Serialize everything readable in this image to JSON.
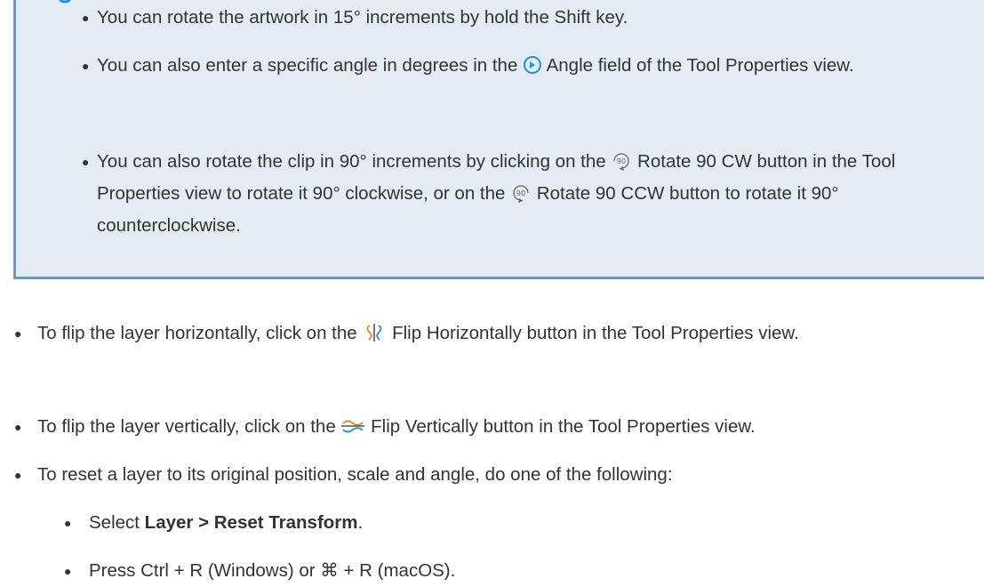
{
  "tip": {
    "items": [
      {
        "text": "You can rotate the artwork in 15° increments by hold the Shift key."
      },
      {
        "pre": "You can also enter a specific angle in degrees in the ",
        "icon": "angle-icon",
        "post": " Angle field of the Tool Properties view."
      },
      {
        "pre": "You can also rotate the clip in 90° increments by clicking on the ",
        "icon": "rotate-90-cw-icon",
        "mid": " Rotate 90 CW button in the Tool Properties view to rotate it 90° clockwise, or on the ",
        "icon2": "rotate-90-ccw-icon",
        "post": " Rotate 90 CCW button to rotate it 90° counterclockwise."
      }
    ]
  },
  "steps": [
    {
      "pre": "To flip the layer horizontally, click on the ",
      "icon": "flip-horizontal-icon",
      "post": " Flip Horizontally button in the Tool Properties view."
    },
    {
      "pre": "To flip the layer vertically, click on the ",
      "icon": "flip-vertical-icon",
      "post": " Flip Vertically button in the Tool Properties view."
    },
    {
      "text": "To reset a layer to its original position, scale and angle, do one of the following:"
    }
  ],
  "reset_options": [
    {
      "pre": "Select ",
      "bold": "Layer > Reset Transform",
      "post": "."
    },
    {
      "text": "Press Ctrl + R (Windows) or ⌘ + R (macOS)."
    }
  ],
  "colors": {
    "tip_bg": "#e4ebf3",
    "tip_border": "#6e97c9",
    "text": "#333333",
    "icon_accent": "#2a8fd6"
  }
}
